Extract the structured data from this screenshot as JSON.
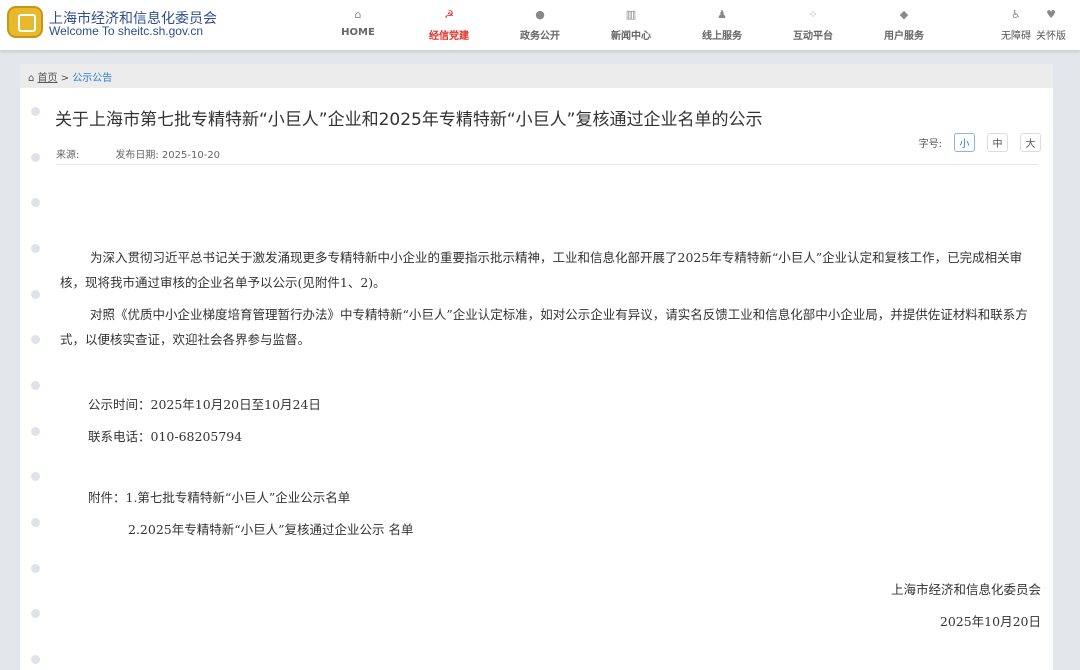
{
  "header": {
    "site_name": "上海市经济和信息化委员会",
    "site_en": "Welcome To sheitc.sh.gov.cn",
    "nav": [
      {
        "label": "HOME",
        "icon": "⌂"
      },
      {
        "label": "经信党建",
        "icon": "☭"
      },
      {
        "label": "政务公开",
        "icon": "●"
      },
      {
        "label": "新闻中心",
        "icon": "▥"
      },
      {
        "label": "线上服务",
        "icon": "♟"
      },
      {
        "label": "互动平台",
        "icon": "⁘"
      },
      {
        "label": "用户服务",
        "icon": "◆"
      }
    ],
    "tools": [
      {
        "label": "无障碍",
        "icon": "♿"
      },
      {
        "label": "关怀版",
        "icon": "♥"
      }
    ]
  },
  "breadcrumb": {
    "home": "首页",
    "sep": ">",
    "current": "公示公告"
  },
  "article": {
    "title": "关于上海市第七批专精特新“小巨人”企业和2025年专精特新“小巨人”复核通过企业名单的公示",
    "source": "来源:",
    "date": "发布日期: 2025-10-20",
    "font_size_label": "字号:",
    "font_sizes": [
      "小",
      "中",
      "大"
    ],
    "paragraphs": [
      "为深入贯彻习近平总书记关于激发涌现更多专精特新中小企业的重要指示批示精神，工业和信息化部开展了2025年专精特新“小巨人”企业认定和复核工作，已完成相关审核，现将我市通过审核的企业名单予以公示(见附件1、2)。",
      "对照《优质中小企业梯度培育管理暂行办法》中专精特新“小巨人”企业认定标准，如对公示企业有异议，请实名反馈工业和信息化部中小企业局，并提供佐证材料和联系方式，以便核实查证，欢迎社会各界参与监督。"
    ],
    "period": "公示时间：2025年10月20日至10月24日",
    "phone": "联系电话：010-68205794",
    "attachment1": "附件：1.第七批专精特新“小巨人”企业公示名单",
    "attachment2": "2.2025年专精特新“小巨人”复核通过企业公示 名单",
    "signature": "上海市经济和信息化委员会",
    "sign_date": "2025年10月20日"
  }
}
